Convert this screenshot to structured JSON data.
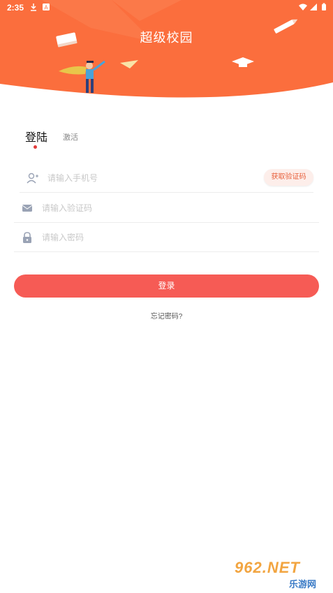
{
  "status_bar": {
    "time": "2:35",
    "icons": [
      "download-icon",
      "a-notification-icon",
      "wifi-icon",
      "signal-icon",
      "battery-icon"
    ]
  },
  "header": {
    "title": "超级校园",
    "background_color": "#fb6e3d"
  },
  "tabs": [
    {
      "label": "登陆",
      "active": true
    },
    {
      "label": "激活",
      "active": false
    }
  ],
  "form": {
    "phone_placeholder": "请输入手机号",
    "code_placeholder": "请输入验证码",
    "password_placeholder": "请输入密码",
    "get_code_label": "获取验证码",
    "login_label": "登录",
    "forgot_label": "忘记密码?"
  },
  "watermark": {
    "main": "962.NET",
    "sub": "乐游网"
  },
  "colors": {
    "accent": "#f65b55",
    "code_text": "#e8603c",
    "code_bg": "#fdeeea"
  }
}
